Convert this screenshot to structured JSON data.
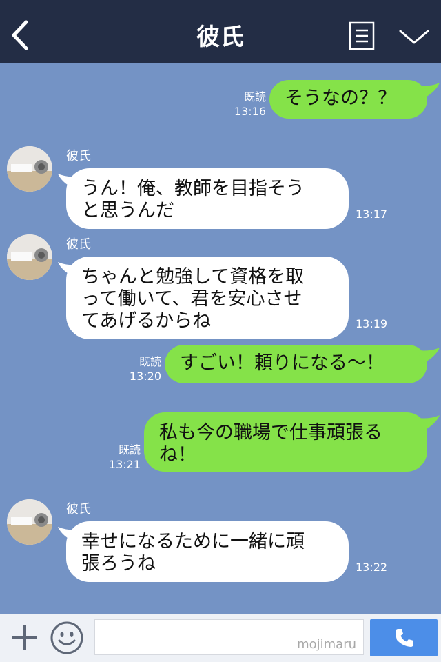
{
  "header": {
    "title": "彼氏"
  },
  "messages": [
    {
      "text": "そうなの？？",
      "read": "既読",
      "time": "13:16"
    },
    {
      "name": "彼氏",
      "text": "うん！俺、教師を目指そう\nと思うんだ",
      "time": "13:17"
    },
    {
      "name": "彼氏",
      "text": "ちゃんと勉強して資格を取\nって働いて、君を安心させ\nてあげるからね",
      "time": "13:19"
    },
    {
      "text": "すごい！頼りになる〜！",
      "read": "既読",
      "time": "13:20"
    },
    {
      "text": "私も今の職場で仕事頑張る\nね！",
      "read": "既読",
      "time": "13:21"
    },
    {
      "name": "彼氏",
      "text": "幸せになるために一緒に頑\n張ろうね",
      "time": "13:22"
    }
  ],
  "footer": {
    "watermark": "mojimaru",
    "input_value": ""
  },
  "colors": {
    "chat_bg": "#7493c5",
    "header_bg": "#232d45",
    "outgoing": "#85e249",
    "incoming": "#ffffff",
    "send": "#4c8ee8"
  },
  "icons": [
    "back-arrow-icon",
    "menu-icon",
    "chevron-down-icon",
    "plus-icon",
    "emoji-icon",
    "phone-icon"
  ]
}
